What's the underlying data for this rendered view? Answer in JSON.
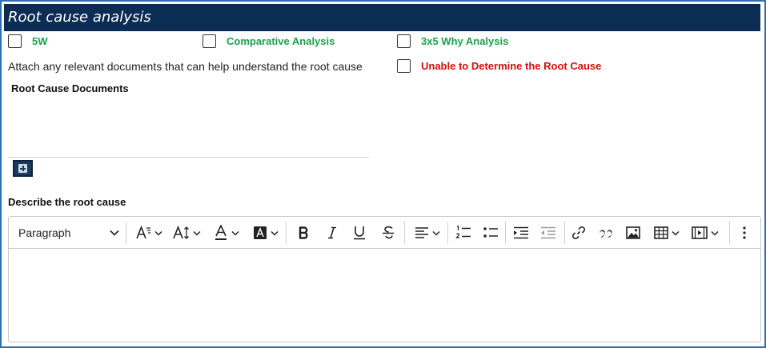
{
  "header": {
    "title": "Root cause analysis"
  },
  "options": {
    "five_w": "5W",
    "comparative": "Comparative Analysis",
    "three_by_five": "3x5 Why Analysis",
    "unable": "Unable to Determine the Root Cause"
  },
  "attach": {
    "hint": "Attach any relevant documents that can help understand the root cause",
    "documents_title": "Root Cause Documents"
  },
  "describe": {
    "label": "Describe the root cause"
  },
  "editor": {
    "paragraph_label": "Paragraph",
    "toolbar_icons": [
      "font-size-icon",
      "line-height-icon",
      "font-color-icon",
      "highlight-icon",
      "bold-icon",
      "italic-icon",
      "underline-icon",
      "strikethrough-icon",
      "align-icon",
      "numbered-list-icon",
      "bulleted-list-icon",
      "indent-icon",
      "outdent-icon",
      "link-icon",
      "quote-icon",
      "image-icon",
      "table-icon",
      "media-icon",
      "more-icon"
    ]
  },
  "colors": {
    "header_bg": "#0b2d55",
    "green_label": "#1aa14a",
    "red_label": "#d80d0d",
    "frame_border": "#2f6fb5"
  }
}
